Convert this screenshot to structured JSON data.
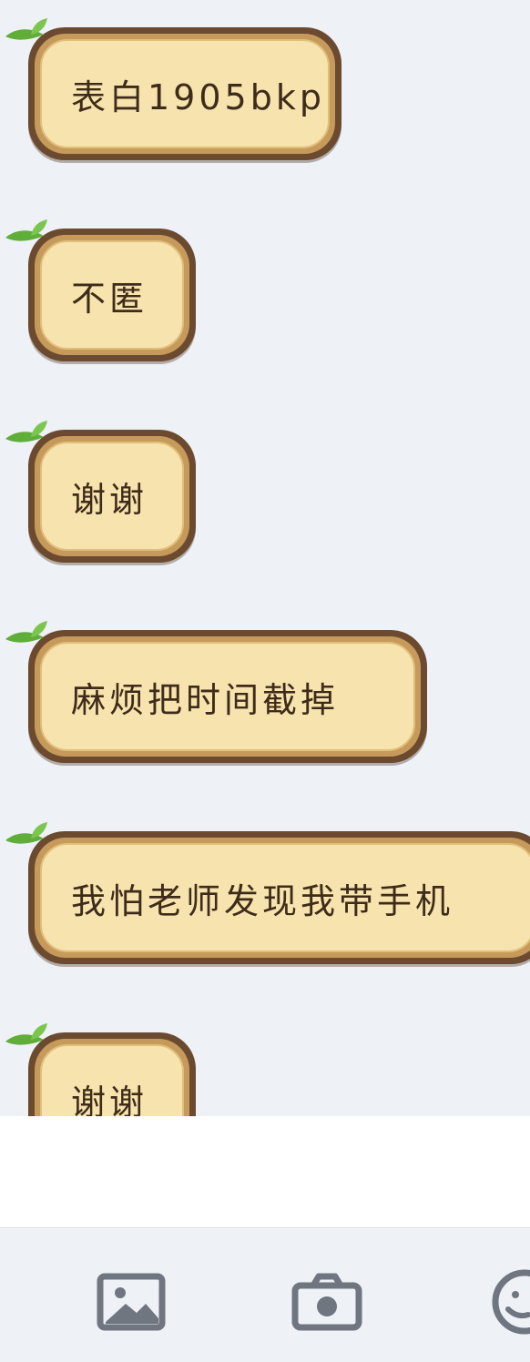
{
  "messages": [
    {
      "text": "表白1905bkp"
    },
    {
      "text": "不匿"
    },
    {
      "text": "谢谢"
    },
    {
      "text": "麻烦把时间截掉"
    },
    {
      "text": "我怕老师发现我带手机"
    },
    {
      "text": "谢谢"
    }
  ],
  "input": {
    "value": ""
  },
  "toolbar": {
    "icons": [
      "image-icon",
      "camera-icon",
      "emoji-icon"
    ]
  },
  "colors": {
    "background": "#eef1f6",
    "bubble_fill": "#f6e3ae",
    "bubble_border_dark": "#6b4a30",
    "bubble_border_mid": "#c69a5a",
    "leaf": "#5fae3a",
    "text": "#3e2b1a",
    "icon": "#6f7680"
  }
}
